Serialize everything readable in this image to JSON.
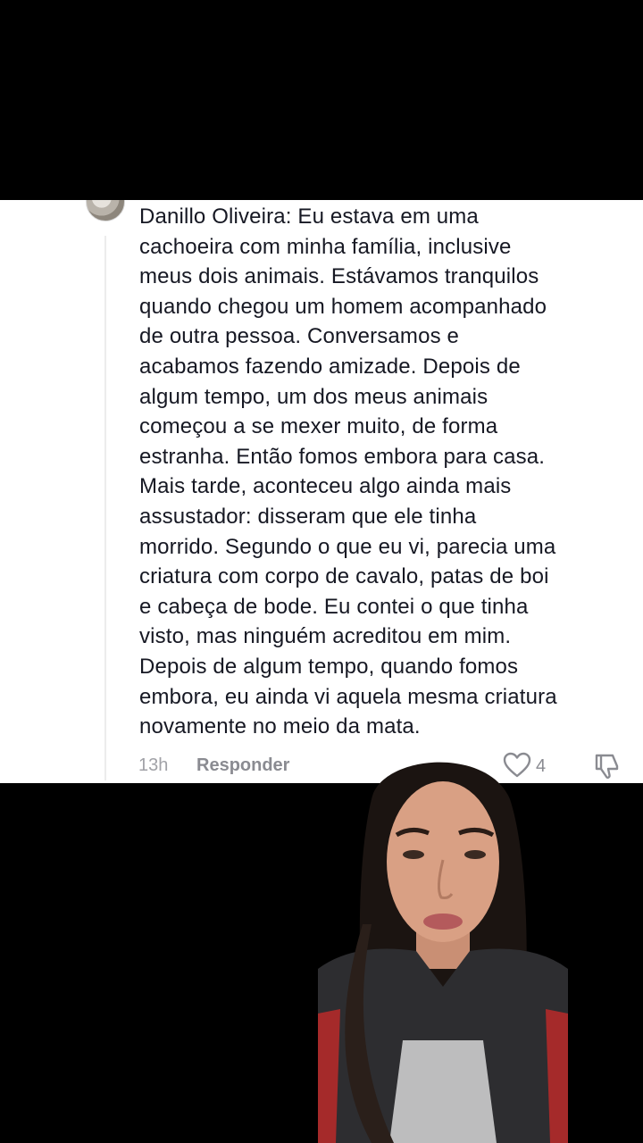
{
  "comment": {
    "text": "Danillo Oliveira: Eu estava em uma\ncachoeira com minha família, inclusive\nmeus dois animais. Estávamos tranquilos\nquando chegou um homem acompanhado\nde outra pessoa. Conversamos e\nacabamos fazendo amizade. Depois de\nalgum tempo, um dos meus animais\ncomeçou a se mexer muito, de forma\nestranha. Então fomos embora para casa.\nMais tarde, aconteceu algo ainda mais\nassustador: disseram que ele tinha\nmorrido. Segundo o que eu vi, parecia uma\ncriatura com corpo de cavalo, patas de boi\ne cabeça de bode. Eu contei o que tinha\nvisto, mas ninguém acreditou em mim.\nDepois de algum tempo, quando fomos\nembora, eu ainda vi aquela mesma criatura\nnovamente no meio da mata.",
    "time": "13h",
    "reply_label": "Responder",
    "like_count": "4"
  },
  "icons": {
    "like": "heart-icon",
    "dislike": "thumbs-down-icon"
  },
  "colors": {
    "text": "#161823",
    "muted": "#a1a2a7",
    "background": "#000000",
    "card": "#ffffff"
  }
}
